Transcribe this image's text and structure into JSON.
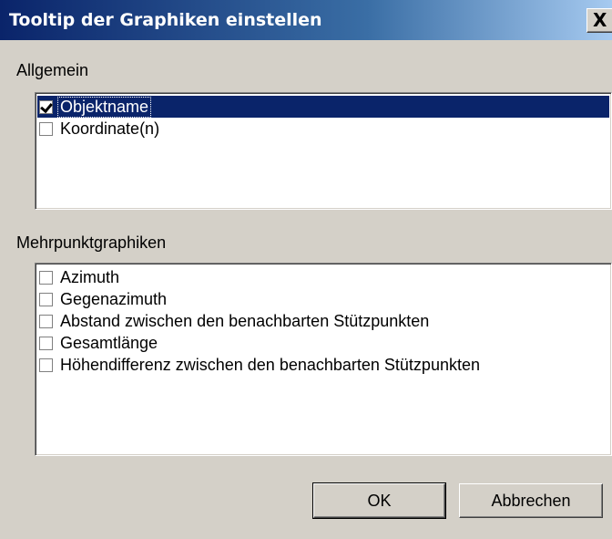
{
  "dialog": {
    "title": "Tooltip der Graphiken einstellen",
    "close_label": "X"
  },
  "groups": {
    "general": {
      "label": "Allgemein",
      "items": [
        {
          "label": "Objektname",
          "checked": true,
          "selected": true
        },
        {
          "label": "Koordinate(n)",
          "checked": false,
          "selected": false
        }
      ]
    },
    "multipoint": {
      "label": "Mehrpunktgraphiken",
      "items": [
        {
          "label": "Azimuth",
          "checked": false
        },
        {
          "label": "Gegenazimuth",
          "checked": false
        },
        {
          "label": "Abstand zwischen den benachbarten Stützpunkten",
          "checked": false
        },
        {
          "label": "Gesamtlänge",
          "checked": false
        },
        {
          "label": "Höhendifferenz zwischen den benachbarten Stützpunkten",
          "checked": false
        }
      ]
    }
  },
  "buttons": {
    "ok_label": "OK",
    "cancel_label": "Abbrechen"
  },
  "colors": {
    "titlebar_start": "#0a246a",
    "titlebar_end": "#a6caf0",
    "selection": "#0a246a",
    "dialog_face": "#d4d0c8"
  }
}
